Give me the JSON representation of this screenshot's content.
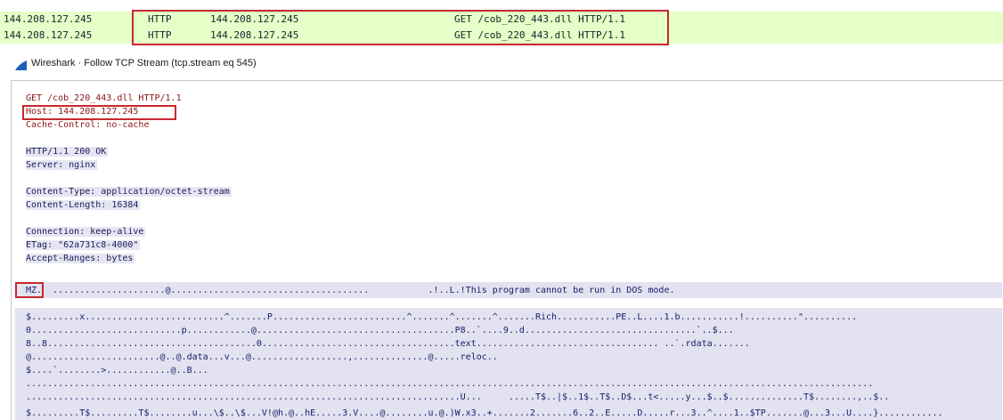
{
  "packet_list": {
    "rows": [
      {
        "source": "144.208.127.245",
        "protocol": "HTTP",
        "destination": "144.208.127.245",
        "info": "GET /cob_220_443.dll HTTP/1.1"
      },
      {
        "source": "144.208.127.245",
        "protocol": "HTTP",
        "destination": "144.208.127.245",
        "info": "GET /cob_220_443.dll HTTP/1.1"
      }
    ]
  },
  "window": {
    "title": "Wireshark · Follow TCP Stream (tcp.stream eq 545)",
    "icon": "wireshark-fin-icon"
  },
  "stream": {
    "request_lines": [
      "GET /cob_220_443.dll HTTP/1.1",
      "Host: 144.208.127.245",
      "Cache-Control: no-cache"
    ],
    "response_lines": [
      "HTTP/1.1 200 OK",
      "Server: nginx",
      "",
      "Content-Type: application/octet-stream",
      "Content-Length: 16384",
      "",
      "Connection: keep-alive",
      "ETag: \"62a731c8-4000\"",
      "Accept-Ranges: bytes"
    ],
    "mz_line": "MZ.  .....................@.....................................           .!..L.!This program cannot be run in DOS mode.",
    "dump_lines": [
      "$.........x..........................^.......P.........................^.......^.......^.......Rich...........PE..L....1.b...........!..........\"..........",
      "0............................p............@.....................................P8..`....9..d................................`..$...",
      "8..8.......................................0....................................text.................................. ..`.rdata.......",
      "@........................@..@.data...v...@..................,..............@.....reloc..",
      "$....`........>............@..B...",
      "..............................................................................................................................................................",
      ".................................................................................U...     .....T$..|$..1$..T$..D$...t<.....y...$..$..............T$........,..$..",
      "$.........T$.........T$........u...\\$..\\$...V!@h.@..hE.....3.V....@........u.@.)W.x3..+.......2.......6..2..E.....D.....r...3..^....1..$TP.......@...3...U....}............"
    ]
  }
}
